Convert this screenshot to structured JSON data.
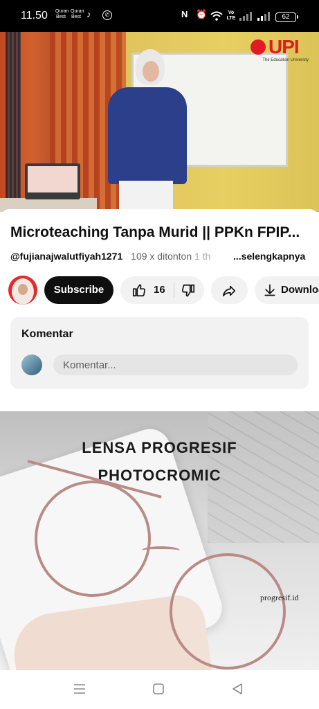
{
  "status_bar": {
    "time": "11.50",
    "notif_app1": "Quran Best",
    "notif_app2": "Quran Best",
    "volte": "Vo LTE",
    "battery": "62"
  },
  "video": {
    "brand_logo": "UPI",
    "brand_tagline": "The Education University"
  },
  "details": {
    "title": "Microteaching Tanpa Murid || PPKn FPIP...",
    "channel": "@fujianajwalutfiyah1271",
    "views": "109 x ditonton",
    "age": "1 th",
    "more_label": "...selengkapnya"
  },
  "actions": {
    "subscribe_label": "Subscribe",
    "like_count": "16",
    "download_label": "Download"
  },
  "comments": {
    "header": "Komentar",
    "placeholder": "Komentar..."
  },
  "ad": {
    "headline1": "LENSA PROGRESIF",
    "headline2": "PHOTOCROMIC",
    "watermark": "progresif.id"
  },
  "colors": {
    "brand_red": "#e11b22",
    "subscribe_bg": "#0f0f0f",
    "pill_bg": "#f2f2f2"
  },
  "icons": [
    "tiktok-icon",
    "whatsapp-icon",
    "nfc-icon",
    "alarm-icon",
    "wifi-icon",
    "signal-icon",
    "like-icon",
    "dislike-icon",
    "share-icon",
    "download-icon",
    "menu-icon",
    "home-icon",
    "back-icon"
  ]
}
